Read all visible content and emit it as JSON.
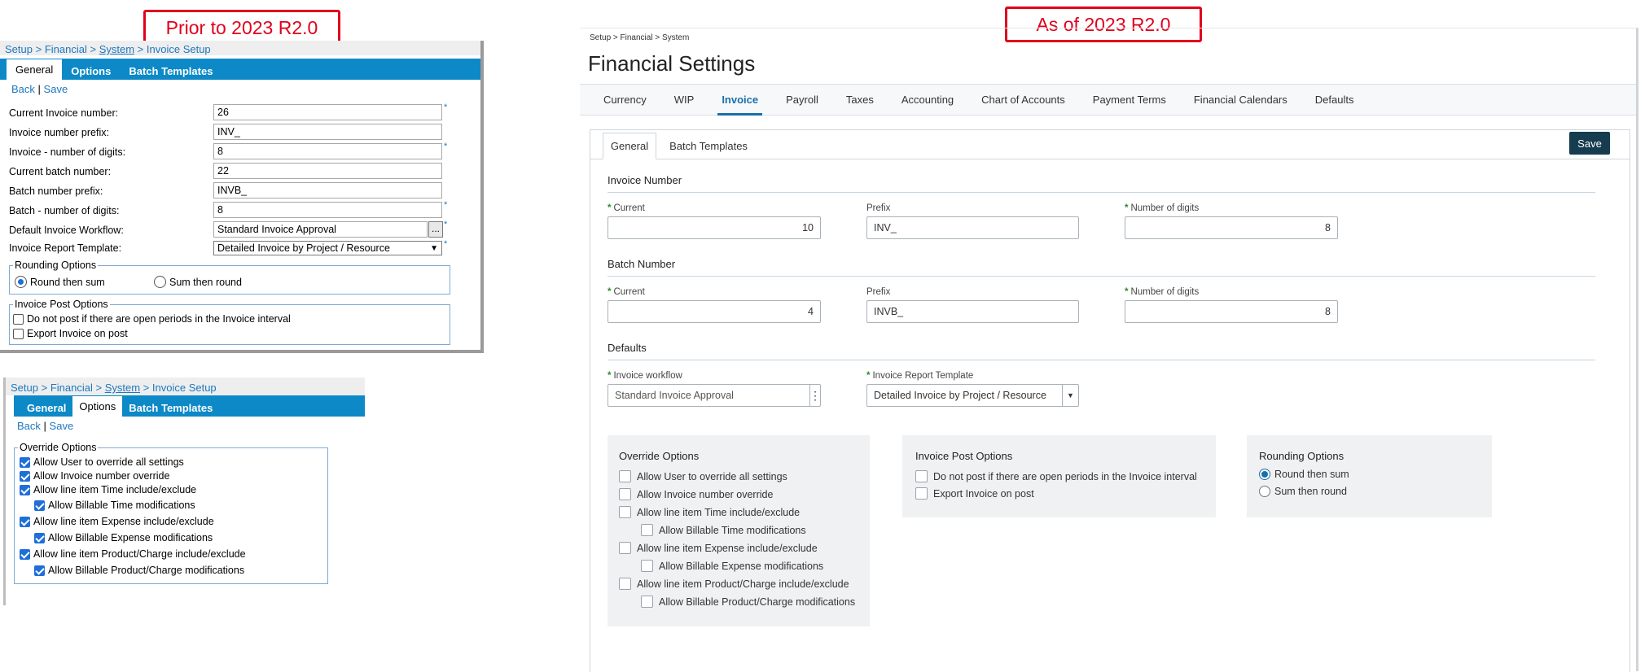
{
  "callouts": {
    "old": "Prior to 2023 R2.0",
    "new": "As of 2023 R2.0"
  },
  "old_general": {
    "breadcrumb": {
      "setup": "Setup",
      "financial": "Financial",
      "system": "System",
      "page": "Invoice Setup",
      "sep": ">"
    },
    "tabs": [
      "General",
      "Options",
      "Batch Templates"
    ],
    "links": {
      "back": "Back",
      "sep": "|",
      "save": "Save"
    },
    "fields": [
      {
        "label": "Current Invoice number:",
        "value": "26",
        "required": true
      },
      {
        "label": "Invoice number prefix:",
        "value": "INV_",
        "required": false
      },
      {
        "label": "Invoice - number of digits:",
        "value": "8",
        "required": true
      },
      {
        "label": "Current batch number:",
        "value": "22",
        "required": false
      },
      {
        "label": "Batch number prefix:",
        "value": "INVB_",
        "required": false
      },
      {
        "label": "Batch - number of digits:",
        "value": "8",
        "required": true
      },
      {
        "label": "Default Invoice Workflow:",
        "value": "Standard Invoice Approval",
        "required": true
      },
      {
        "label": "Invoice Report Template:",
        "value": "Detailed Invoice by Project / Resource",
        "required": true
      }
    ],
    "required_mark": "*",
    "dots": "...",
    "rounding": {
      "legend": "Rounding Options",
      "opt1": "Round then sum",
      "opt2": "Sum then round"
    },
    "post": {
      "legend": "Invoice Post Options",
      "opt1": "Do not post if there are open periods in the Invoice interval",
      "opt2": "Export Invoice on post"
    }
  },
  "old_options": {
    "breadcrumb": {
      "setup": "Setup",
      "financial": "Financial",
      "system": "System",
      "page": "Invoice Setup",
      "sep": ">"
    },
    "tabs": [
      "General",
      "Options",
      "Batch Templates"
    ],
    "links": {
      "back": "Back",
      "sep": "|",
      "save": "Save"
    },
    "override": {
      "legend": "Override Options",
      "items": [
        "Allow User to override all settings",
        "Allow Invoice number override",
        "Allow line item Time include/exclude",
        "Allow Billable Time modifications",
        "Allow line item Expense include/exclude",
        "Allow Billable Expense modifications",
        "Allow line item Product/Charge include/exclude",
        "Allow Billable Product/Charge modifications"
      ]
    }
  },
  "new_ui": {
    "breadcrumb": "Setup > Financial > System",
    "title": "Financial Settings",
    "tabs": [
      "Currency",
      "WIP",
      "Invoice",
      "Payroll",
      "Taxes",
      "Accounting",
      "Chart of Accounts",
      "Payment Terms",
      "Financial Calendars",
      "Defaults"
    ],
    "subtabs": [
      "General",
      "Batch Templates"
    ],
    "save": "Save",
    "invoice_number": {
      "heading": "Invoice Number",
      "current_label": "Current",
      "current": "10",
      "prefix_label": "Prefix",
      "prefix": "INV_",
      "digits_label": "Number of digits",
      "digits": "8"
    },
    "batch_number": {
      "heading": "Batch Number",
      "current_label": "Current",
      "current": "4",
      "prefix_label": "Prefix",
      "prefix": "INVB_",
      "digits_label": "Number of digits",
      "digits": "8"
    },
    "defaults": {
      "heading": "Defaults",
      "workflow_label": "Invoice workflow",
      "workflow": "Standard Invoice Approval",
      "template_label": "Invoice Report Template",
      "template": "Detailed Invoice by Project / Resource"
    },
    "required_mark": "*",
    "override": {
      "title": "Override Options",
      "items": [
        "Allow User to override all settings",
        "Allow Invoice number override",
        "Allow line item Time include/exclude",
        "Allow Billable Time modifications",
        "Allow line item Expense include/exclude",
        "Allow Billable Expense modifications",
        "Allow line item Product/Charge include/exclude",
        "Allow Billable Product/Charge modifications"
      ]
    },
    "post": {
      "title": "Invoice Post Options",
      "opt1": "Do not post if there are open periods in the Invoice interval",
      "opt2": "Export Invoice on post"
    },
    "rounding": {
      "title": "Rounding Options",
      "opt1": "Round then sum",
      "opt2": "Sum then round"
    }
  },
  "colors": {
    "callout_red": "#e0001b",
    "old_tab_blue": "#0d89c7",
    "link_blue": "#1e78be",
    "new_accent": "#1b6fa8",
    "save_dark": "#163c4f",
    "required_green": "#2e8a2e"
  }
}
